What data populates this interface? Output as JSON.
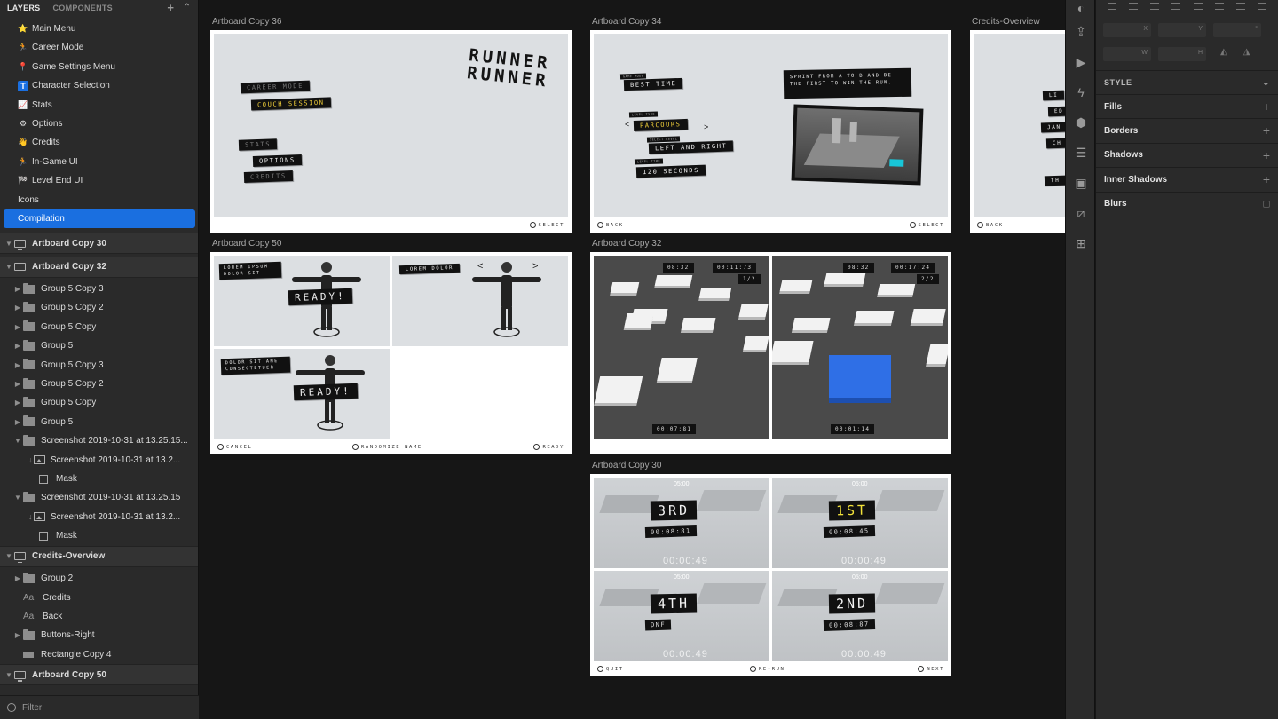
{
  "layers_panel": {
    "tab_layers": "LAYERS",
    "tab_components": "COMPONENTS",
    "add_glyph": "+",
    "collapse_glyph": "^",
    "pages": [
      {
        "label": "Main Menu",
        "icon": "star-emoji-icon",
        "glyph": "⭐"
      },
      {
        "label": "Career Mode",
        "icon": "runner-emoji-icon",
        "glyph": "🏃"
      },
      {
        "label": "Game Settings Menu",
        "icon": "pin-emoji-icon",
        "glyph": "📍"
      },
      {
        "label": "Character Selection",
        "icon": "letter-t-emoji-icon",
        "glyph": "T"
      },
      {
        "label": "Stats",
        "icon": "chart-emoji-icon",
        "glyph": "📈"
      },
      {
        "label": "Options",
        "icon": "gear-emoji-icon",
        "glyph": "⚙"
      },
      {
        "label": "Credits",
        "icon": "waving-hand-emoji-icon",
        "glyph": "👋"
      },
      {
        "label": "In-Game UI",
        "icon": "runner-emoji-icon",
        "glyph": "🏃"
      },
      {
        "label": "Level End UI",
        "icon": "checkered-flag-emoji-icon",
        "glyph": "🏁"
      },
      {
        "label": "Icons",
        "icon": "",
        "glyph": ""
      },
      {
        "label": "Compilation",
        "icon": "",
        "glyph": ""
      }
    ],
    "selected_page": "Compilation",
    "tree": [
      {
        "label": "Artboard Copy 30",
        "kind": "artboard",
        "depth": 0,
        "expanded": true
      },
      {
        "label": "Artboard Copy 32",
        "kind": "artboard",
        "depth": 0,
        "expanded": true
      },
      {
        "label": "Group 5 Copy 3",
        "kind": "group",
        "depth": 1,
        "expanded": false
      },
      {
        "label": "Group 5 Copy 2",
        "kind": "group",
        "depth": 1,
        "expanded": false
      },
      {
        "label": "Group 5 Copy",
        "kind": "group",
        "depth": 1,
        "expanded": false
      },
      {
        "label": "Group 5",
        "kind": "group",
        "depth": 1,
        "expanded": false
      },
      {
        "label": "Group 5 Copy 3",
        "kind": "group",
        "depth": 1,
        "expanded": false
      },
      {
        "label": "Group 5 Copy 2",
        "kind": "group",
        "depth": 1,
        "expanded": false
      },
      {
        "label": "Group 5 Copy",
        "kind": "group",
        "depth": 1,
        "expanded": false
      },
      {
        "label": "Group 5",
        "kind": "group",
        "depth": 1,
        "expanded": false
      },
      {
        "label": "Screenshot 2019-10-31 at 13.25.15...",
        "kind": "group",
        "depth": 1,
        "expanded": true
      },
      {
        "label": "Screenshot 2019-10-31 at 13.2...",
        "kind": "image",
        "depth": 2
      },
      {
        "label": "Mask",
        "kind": "mask",
        "depth": 2
      },
      {
        "label": "Screenshot 2019-10-31 at 13.25.15",
        "kind": "group",
        "depth": 1,
        "expanded": true
      },
      {
        "label": "Screenshot 2019-10-31 at 13.2...",
        "kind": "image",
        "depth": 2
      },
      {
        "label": "Mask",
        "kind": "mask",
        "depth": 2
      },
      {
        "label": "Credits-Overview",
        "kind": "artboard",
        "depth": 0,
        "expanded": true
      },
      {
        "label": "Group 2",
        "kind": "group",
        "depth": 1,
        "expanded": false
      },
      {
        "label": "Credits",
        "kind": "text",
        "depth": 1
      },
      {
        "label": "Back",
        "kind": "text",
        "depth": 1
      },
      {
        "label": "Buttons-Right",
        "kind": "group",
        "depth": 1,
        "expanded": false
      },
      {
        "label": "Rectangle Copy 4",
        "kind": "rect",
        "depth": 1
      },
      {
        "label": "Artboard Copy 50",
        "kind": "artboard",
        "depth": 0,
        "expanded": true
      }
    ],
    "text_layer_glyph": "Aa",
    "filter_label": "Filter"
  },
  "canvas": {
    "artboards": {
      "a36": {
        "label": "Artboard Copy 36",
        "title_line1": "RUNNER",
        "title_line2": "RUNNER",
        "menu": [
          "CAREER MODE",
          "COUCH SESSION",
          "STATS",
          "OPTIONS",
          "CREDITS"
        ],
        "footer_select": "SELECT"
      },
      "a34": {
        "label": "Artboard Copy 34",
        "game_mode_caption": "GAME MODE",
        "game_mode": "BEST TIME",
        "level_type_caption": "LEVEL TYPE",
        "level_type": "PARCOURS",
        "select_level_caption": "SELECT LEVEL",
        "select_level": "LEFT AND RIGHT",
        "level_time_caption": "LEVEL TIME",
        "level_time": "120 SECONDS",
        "description": "SPRINT FROM A TO B AND BE THE FIRST TO WIN THE RUN.",
        "arrow_left": "<",
        "arrow_right": ">",
        "footer_back": "BACK",
        "footer_select": "SELECT"
      },
      "credits": {
        "label": "Credits-Overview",
        "partial_lines": [
          "LI",
          "ED",
          "JAN",
          "CH",
          "TH"
        ],
        "footer_back": "BACK"
      },
      "a50": {
        "label": "Artboard Copy 50",
        "p1_tag": "LOREM IPSUM DOLOR SIT",
        "p1_ready": "READY!",
        "p2_tag": "LOREM DOLOR",
        "p2_left": "<",
        "p2_right": ">",
        "p3_tag": "DOLOR SIT AMET CONSECTETUER",
        "p3_ready": "READY!",
        "footer_cancel": "CANCEL",
        "footer_random": "RANDOMIZE NAME",
        "footer_ready": "READY"
      },
      "a32": {
        "label": "Artboard Copy 32",
        "left": {
          "timer_a": "08:32",
          "timer_b": "00:11:73",
          "lap": "1/2",
          "bottom": "00:07:81"
        },
        "right": {
          "timer_a": "08:32",
          "timer_b": "00:17:24",
          "lap": "2/2",
          "bottom": "00:01:14"
        }
      },
      "a30": {
        "label": "Artboard Copy 30",
        "quads": [
          {
            "top": "05:00",
            "rank": "3RD",
            "time": "00:08:81",
            "ghost": "00:00:49",
            "gold": false
          },
          {
            "top": "05:00",
            "rank": "1ST",
            "time": "00:08:45",
            "ghost": "00:00:49",
            "gold": true
          },
          {
            "top": "05:00",
            "rank": "4TH",
            "time": "DNF",
            "ghost": "00:00:49",
            "gold": false
          },
          {
            "top": "05:00",
            "rank": "2ND",
            "time": "00:08:87",
            "ghost": "00:00:49",
            "gold": false
          }
        ],
        "footer_quit": "QUIT",
        "footer_rerun": "RE-RUN",
        "footer_next": "NEXT"
      }
    }
  },
  "toolstrip": {
    "tools": [
      "palette-icon",
      "export-icon",
      "play-icon",
      "lightning-icon",
      "hexagon-icon",
      "list-icon",
      "component-icon",
      "crop-icon",
      "add-image-icon"
    ]
  },
  "inspector": {
    "pos_labels": {
      "x": "X",
      "y": "Y",
      "w": "W",
      "h": "H",
      "r": "°"
    },
    "style_title": "STYLE",
    "sections": [
      "Fills",
      "Borders",
      "Shadows",
      "Inner Shadows",
      "Blurs"
    ],
    "plus_glyph": "+",
    "chevron_glyph": "⌄"
  },
  "colors": {
    "selection": "#1a6fe0",
    "panel": "#2a2a2a",
    "canvas": "#161616",
    "gold_text": "#f2e23a",
    "cyan_block": "#18c6d8",
    "blue_block": "#2f6fe6"
  }
}
